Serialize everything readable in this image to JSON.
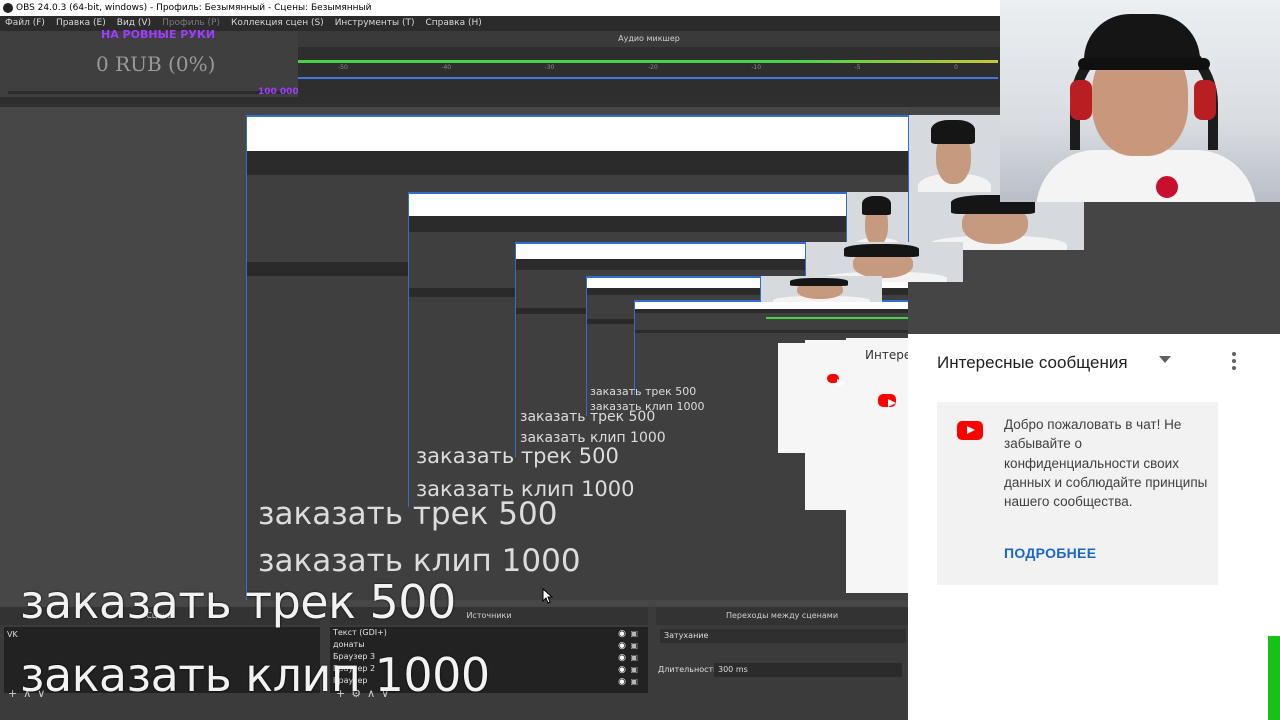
{
  "window": {
    "title": "OBS 24.0.3 (64-bit, windows) - Профиль: Безымянный - Сцены: Безымянный"
  },
  "menu": [
    {
      "label": "Файл (F)",
      "enabled": true
    },
    {
      "label": "Правка (E)",
      "enabled": true
    },
    {
      "label": "Вид (V)",
      "enabled": true
    },
    {
      "label": "Профиль (P)",
      "enabled": false
    },
    {
      "label": "Коллекция сцен (S)",
      "enabled": true
    },
    {
      "label": "Инструменты (T)",
      "enabled": true
    },
    {
      "label": "Справка (H)",
      "enabled": true
    }
  ],
  "donation_widget": {
    "title": "НА РОВНЫЕ РУКИ",
    "amount": "0 RUB (0%)",
    "goal": "100 000",
    "progress": 0
  },
  "audio_mixer": {
    "title": "Аудио микшер",
    "scale": [
      "-50",
      "-40",
      "-30",
      "-20",
      "-10",
      "-5",
      "0"
    ]
  },
  "overlay": {
    "order_track": "заказать трек 500",
    "order_clip": "заказать клип 1000"
  },
  "docks": {
    "scenes_title": "Сцены",
    "sources_title": "Источники",
    "transitions_title": "Переходы между сценами"
  },
  "scenes": [
    "VK"
  ],
  "sources": [
    {
      "name": "Текст (GDI+)"
    },
    {
      "name": "донаты"
    },
    {
      "name": "Браузер 3"
    },
    {
      "name": "Браузер 2"
    },
    {
      "name": "Браузер"
    }
  ],
  "transitions": {
    "type": "Затухание",
    "duration_label": "Длительность",
    "duration_value": "300 ms"
  },
  "controls": {
    "add": "+",
    "settings": "⚙",
    "up": "∧",
    "down": "∨"
  },
  "chat": {
    "title": "Интересные сообщения",
    "ghost_title": "Интере",
    "welcome": "Добро пожаловать в чат! Не забывайте о конфиденциальности своих данных и соблюдайте принципы нашего сообщества.",
    "more": "ПОДРОБНЕЕ"
  },
  "colors": {
    "accent_purple": "#a03cff",
    "obs_blue": "#2e6fd1",
    "youtube_red": "#ff0000",
    "link_blue": "#1b66c9"
  },
  "icons": [
    "obs-app-icon",
    "eye-icon",
    "lock-icon",
    "youtube-icon",
    "caret-down-icon",
    "kebab-menu-icon",
    "plus-icon",
    "gear-icon",
    "arrow-up-icon",
    "arrow-down-icon"
  ]
}
